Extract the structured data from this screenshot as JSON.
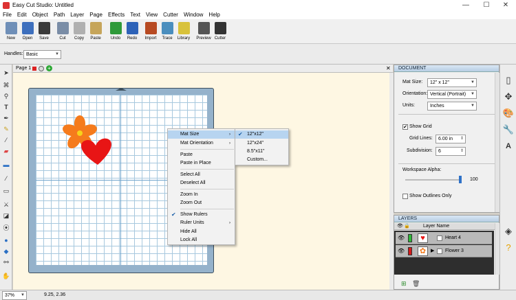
{
  "window": {
    "title": "Easy Cut Studio: Untitled",
    "controls": [
      "—",
      "☐",
      "✕"
    ]
  },
  "menu": [
    "File",
    "Edit",
    "Object",
    "Path",
    "Layer",
    "Page",
    "Effects",
    "Text",
    "View",
    "Cutter",
    "Window",
    "Help"
  ],
  "toolbar": [
    {
      "label": "New",
      "color": "#6f8fb8"
    },
    {
      "label": "Open",
      "color": "#3d6fbd"
    },
    {
      "label": "Save",
      "color": "#3a3a3a"
    },
    {
      "label": "Cut",
      "color": "#7a8da6"
    },
    {
      "label": "Copy",
      "color": "#b0b0b0"
    },
    {
      "label": "Paste",
      "color": "#c6a55a"
    },
    {
      "label": "Undo",
      "color": "#2f9a3a"
    },
    {
      "label": "Redo",
      "color": "#2e63b8"
    },
    {
      "label": "Import",
      "color": "#b74a22"
    },
    {
      "label": "Trace",
      "color": "#4a8ebe"
    },
    {
      "label": "Library",
      "color": "#d8c23b"
    },
    {
      "label": "Preview",
      "color": "#555"
    },
    {
      "label": "Cutter",
      "color": "#333"
    }
  ],
  "handles": {
    "label": "Handles:",
    "value": "Basic"
  },
  "page_tab": {
    "label": "Page 1"
  },
  "context_menu": [
    {
      "label": "Mat Size",
      "arrow": "›",
      "highlighted": true
    },
    {
      "label": "Mat Orientation",
      "arrow": "›"
    },
    {
      "label": "Paste"
    },
    {
      "label": "Paste in Place"
    },
    {
      "label": "Select All"
    },
    {
      "label": "Deselect All"
    },
    {
      "label": "Zoom In"
    },
    {
      "label": "Zoom Out"
    },
    {
      "label": "Show Rulers",
      "checked": true
    },
    {
      "label": "Ruler Units",
      "arrow": "›"
    },
    {
      "label": "Hide All"
    },
    {
      "label": "Lock All"
    }
  ],
  "submenu": [
    {
      "label": "12\"x12\"",
      "checked": true,
      "highlighted": true
    },
    {
      "label": "12\"x24\""
    },
    {
      "label": "8.5\"x11\""
    },
    {
      "label": "Custom..."
    }
  ],
  "document": {
    "header": "DOCUMENT",
    "mat_size_label": "Mat Size:",
    "mat_size": "12\" x 12\"",
    "orientation_label": "Orientation:",
    "orientation": "Vertical (Portrait)",
    "units_label": "Units:",
    "units": "Inches",
    "show_grid_label": "Show Grid",
    "show_grid": true,
    "grid_lines_label": "Grid Lines:",
    "grid_lines": "6.00 in",
    "subdivision_label": "Subdivision:",
    "subdivision": "6",
    "workspace_alpha_label": "Workspace Alpha:",
    "workspace_alpha": "100",
    "show_outlines_label": "Show Outlines Only",
    "show_outlines": false
  },
  "layers": {
    "header": "LAYERS",
    "col_name": "Layer Name",
    "items": [
      {
        "name": "Heart 4",
        "color": "#2db838"
      },
      {
        "name": "Flower 3",
        "color": "#d41b1b"
      }
    ]
  },
  "status": {
    "zoom": "37%",
    "coords": "9.25, 2.36"
  },
  "colors": {
    "heart": "#e81515",
    "petal": "#f57b1c",
    "center": "#f7d21a"
  }
}
